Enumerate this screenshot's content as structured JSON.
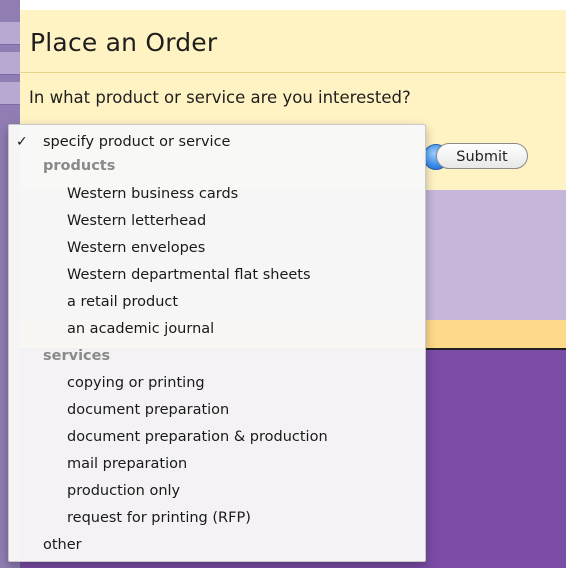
{
  "page": {
    "title": "Place an Order",
    "question": "In what product or service are you interested?",
    "submit_label": "Submit"
  },
  "dropdown": {
    "selected": "specify product or service",
    "checkmark_glyph": "✓",
    "groups": [
      {
        "label": "products",
        "items": [
          "Western business cards",
          "Western letterhead",
          "Western envelopes",
          "Western departmental flat sheets",
          "a retail product",
          "an academic journal"
        ]
      },
      {
        "label": "services",
        "items": [
          "copying or printing",
          "document preparation",
          "document preparation & production",
          "mail preparation",
          "production only",
          "request for printing (RFP)"
        ]
      }
    ],
    "trailing_item": "other"
  },
  "colors": {
    "order_panel_bg": "#fff3c3",
    "lavender_band": "#c6b6da",
    "gold_band": "#ffd98a",
    "purple_band": "#7a4ca6",
    "left_strip": "#8f7db3"
  },
  "icons": {
    "stepper": "popup-arrows-icon",
    "check": "checkmark-icon"
  }
}
